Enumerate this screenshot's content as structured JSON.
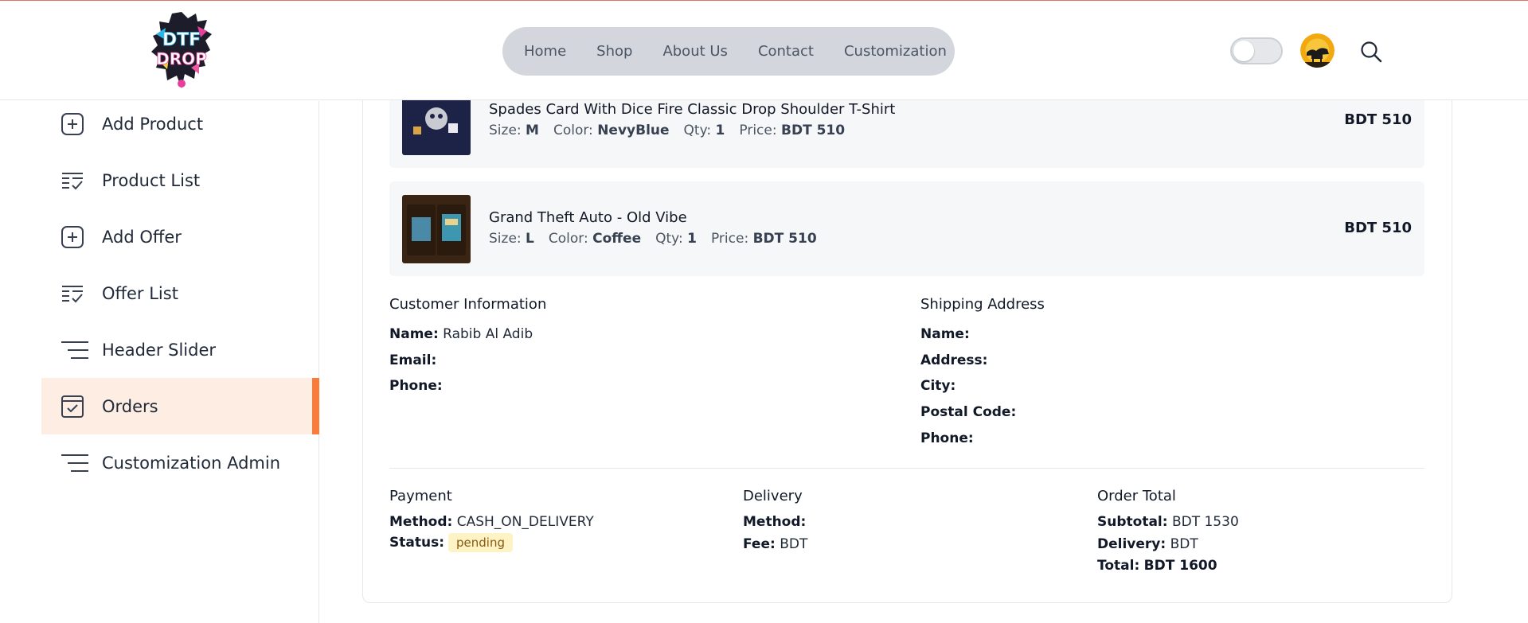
{
  "header": {
    "logo_text_top": "DTF",
    "logo_text_bottom": "DROP",
    "nav": [
      "Home",
      "Shop",
      "About Us",
      "Contact",
      "Customization"
    ]
  },
  "sidebar": {
    "items": [
      {
        "label": "Add Product",
        "icon": "plus-square-icon"
      },
      {
        "label": "Product List",
        "icon": "list-check-icon"
      },
      {
        "label": "Add Offer",
        "icon": "plus-square-icon"
      },
      {
        "label": "Offer List",
        "icon": "list-check-icon"
      },
      {
        "label": "Header Slider",
        "icon": "menu-lines-icon"
      },
      {
        "label": "Orders",
        "icon": "checkbox-calendar-icon"
      },
      {
        "label": "Customization Admin",
        "icon": "menu-lines-icon"
      }
    ],
    "active_index": 5,
    "accent_color": "#f97c3c"
  },
  "order": {
    "items": [
      {
        "name": "Spades Card With Dice Fire Classic Drop Shoulder T-Shirt",
        "size_label": "Size:",
        "size": "M",
        "color_label": "Color:",
        "color": "NevyBlue",
        "qty_label": "Qty:",
        "qty": "1",
        "price_label": "Price:",
        "price": "BDT 510",
        "line_total": "BDT 510"
      },
      {
        "name": "Grand Theft Auto - Old Vibe",
        "size_label": "Size:",
        "size": "L",
        "color_label": "Color:",
        "color": "Coffee",
        "qty_label": "Qty:",
        "qty": "1",
        "price_label": "Price:",
        "price": "BDT 510",
        "line_total": "BDT 510"
      }
    ],
    "customer": {
      "title": "Customer Information",
      "name_label": "Name:",
      "name": "Rabib Al Adib",
      "email_label": "Email:",
      "email": "",
      "phone_label": "Phone:",
      "phone": ""
    },
    "shipping": {
      "title": "Shipping Address",
      "name_label": "Name:",
      "address_label": "Address:",
      "city_label": "City:",
      "postal_label": "Postal Code:",
      "phone_label": "Phone:"
    },
    "payment": {
      "title": "Payment",
      "method_label": "Method:",
      "method": "CASH_ON_DELIVERY",
      "status_label": "Status:",
      "status": "pending"
    },
    "delivery": {
      "title": "Delivery",
      "method_label": "Method:",
      "method": "",
      "fee_label": "Fee:",
      "fee": "BDT"
    },
    "total": {
      "title": "Order Total",
      "subtotal_label": "Subtotal:",
      "subtotal": "BDT 1530",
      "delivery_label": "Delivery:",
      "delivery": "BDT",
      "total_label": "Total:",
      "total": "BDT 1600"
    }
  }
}
